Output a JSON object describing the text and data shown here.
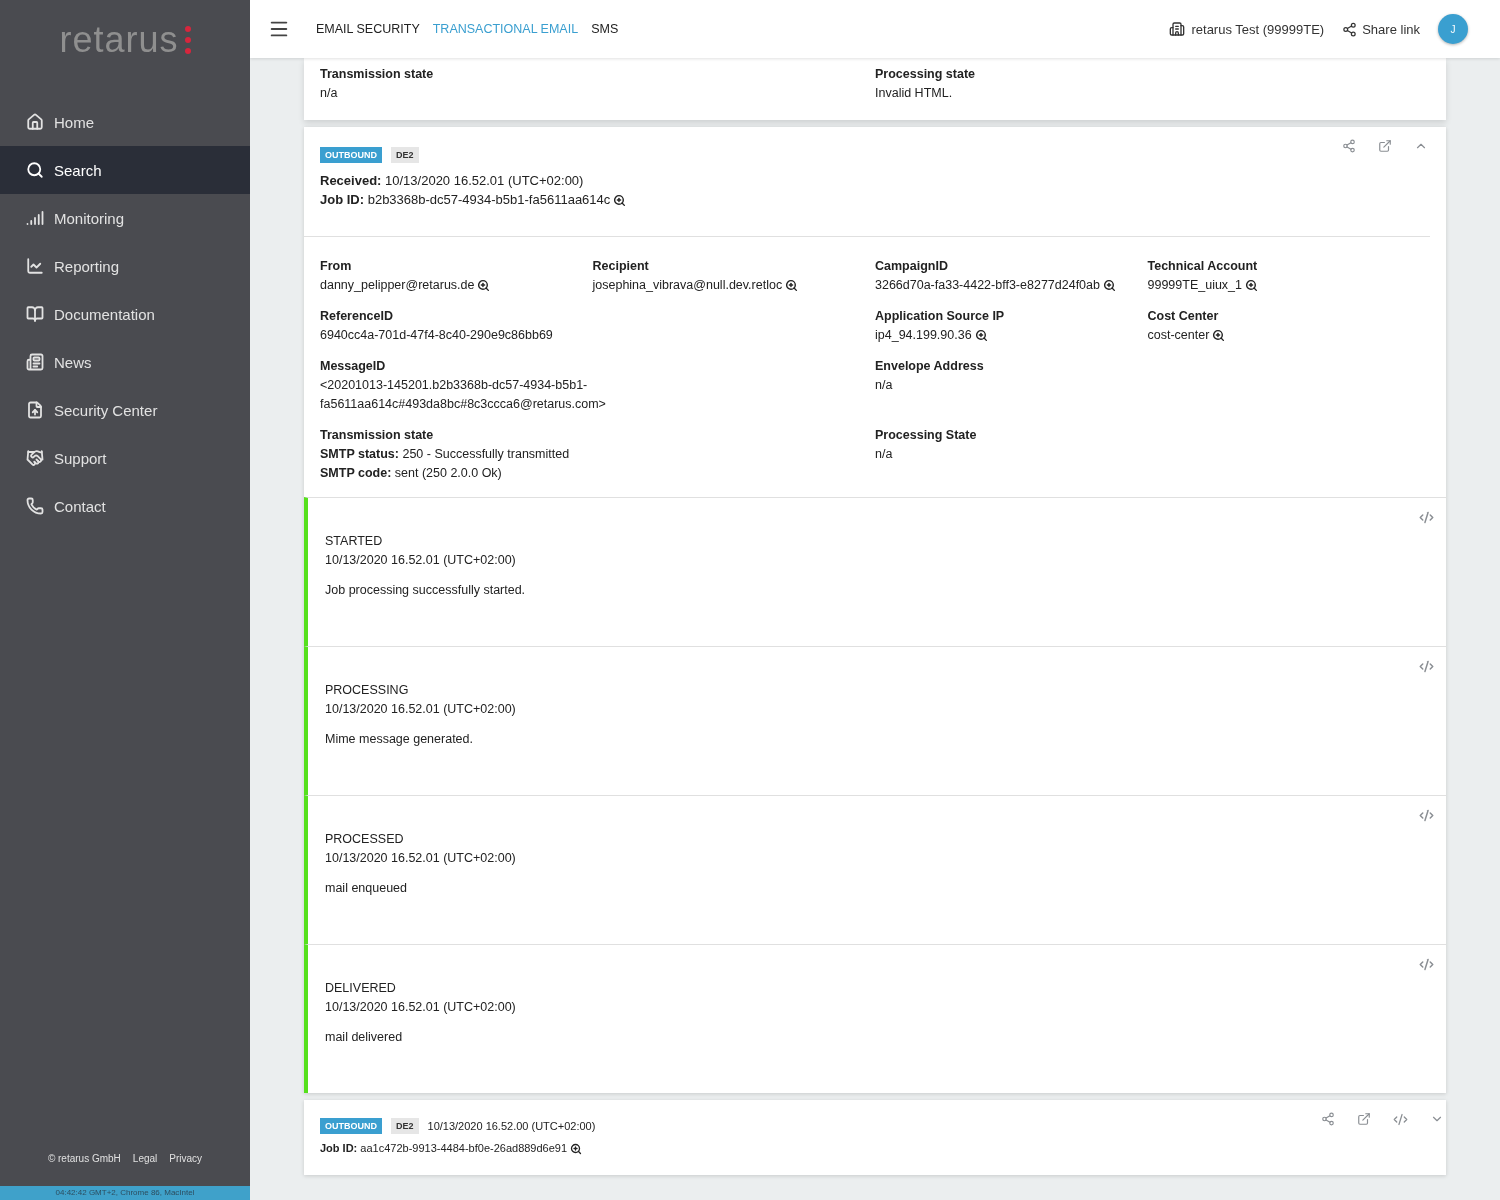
{
  "sidebar": {
    "logo": "retarus",
    "items": [
      {
        "label": "Home",
        "selected": false
      },
      {
        "label": "Search",
        "selected": true
      },
      {
        "label": "Monitoring",
        "selected": false
      },
      {
        "label": "Reporting",
        "selected": false
      },
      {
        "label": "Documentation",
        "selected": false
      },
      {
        "label": "News",
        "selected": false
      },
      {
        "label": "Security Center",
        "selected": false
      },
      {
        "label": "Support",
        "selected": false
      },
      {
        "label": "Contact",
        "selected": false
      }
    ],
    "footer": [
      "© retarus GmbH",
      "Legal",
      "Privacy"
    ],
    "status_bar": "04:42:42 GMT+2, Chrome 86, MacIntel"
  },
  "topbar": {
    "tabs": [
      {
        "label": "EMAIL SECURITY",
        "selected": false
      },
      {
        "label": "TRANSACTIONAL EMAIL",
        "selected": true
      },
      {
        "label": "SMS",
        "selected": false
      }
    ],
    "account": "retarus Test (99999TE)",
    "share": "Share link",
    "avatar": "J"
  },
  "previous_card": {
    "fields": [
      {
        "label": "Transmission state",
        "value": "n/a"
      },
      {
        "label": "Processing state",
        "value": "Invalid HTML."
      }
    ]
  },
  "job_card": {
    "expanded": true,
    "badges": [
      "OUTBOUND",
      "DE2"
    ],
    "received": "**Received:** 10/13/2020 16.52.01 (UTC+02:00)",
    "job_id": "**Job ID:** b2b3368b-dc57-4934-b5b1-fa5611aa614c",
    "rows": [
      {
        "left": [
          {
            "label": "From",
            "lines": [
              "danny_pelipper@retarus.de"
            ],
            "searchable": true
          },
          {
            "label": "Recipient",
            "lines": [
              "josephina_vibrava@null.dev.retloc"
            ],
            "searchable": true
          }
        ],
        "right": [
          {
            "label": "CampaignID",
            "lines": [
              "3266d70a-fa33-4422-bff3-e8277d24f0ab"
            ],
            "searchable": true
          },
          {
            "label": "Technical Account",
            "lines": [
              "99999TE_uiux_1"
            ],
            "searchable": true
          }
        ]
      },
      {
        "left": [
          {
            "label": "ReferenceID",
            "lines": [
              "6940cc4a-701d-47f4-8c40-290e9c86bb69"
            ],
            "searchable": false
          }
        ],
        "right": [
          {
            "label": "Application Source IP",
            "lines": [
              "ip4_94.199.90.36"
            ],
            "searchable": true
          },
          {
            "label": "Cost Center",
            "lines": [
              "cost-center"
            ],
            "searchable": true
          }
        ]
      },
      {
        "left": [
          {
            "label": "MessageID",
            "lines": [
              "<20201013-145201.b2b3368b-dc57-4934-b5b1-fa5611aa614c#493da8bc#8c3ccca6@retarus.com>"
            ],
            "searchable": false
          }
        ],
        "right": [
          {
            "label": "Envelope Address",
            "lines": [
              "n/a"
            ],
            "searchable": false
          }
        ]
      },
      {
        "left": [
          {
            "label": "Transmission state",
            "lines": [
              "**SMTP status:** 250 - Successfully transmitted",
              "**SMTP code:** sent (250 2.0.0 Ok)"
            ],
            "searchable": false
          }
        ],
        "right": [
          {
            "label": "Processing State",
            "lines": [
              "n/a"
            ],
            "searchable": false
          }
        ]
      }
    ],
    "events": [
      {
        "status": "STARTED",
        "time": "10/13/2020 16.52.01 (UTC+02:00)",
        "message": "Job processing successfully started.",
        "color": "#55e01c"
      },
      {
        "status": "PROCESSING",
        "time": "10/13/2020 16.52.01 (UTC+02:00)",
        "message": "Mime message generated.",
        "color": "#55e01c"
      },
      {
        "status": "PROCESSED",
        "time": "10/13/2020 16.52.01 (UTC+02:00)",
        "message": "mail enqueued",
        "color": "#55e01c"
      },
      {
        "status": "DELIVERED",
        "time": "10/13/2020 16.52.01 (UTC+02:00)",
        "message": "mail delivered",
        "color": "#55e01c"
      }
    ]
  },
  "next_card": {
    "expanded": false,
    "badges": [
      "OUTBOUND",
      "DE2"
    ],
    "received": "10/13/2020 16.52.00 (UTC+02:00)",
    "job_id": "**Job ID:** aa1c472b-9913-4484-bf0e-26ad889d6e91"
  }
}
